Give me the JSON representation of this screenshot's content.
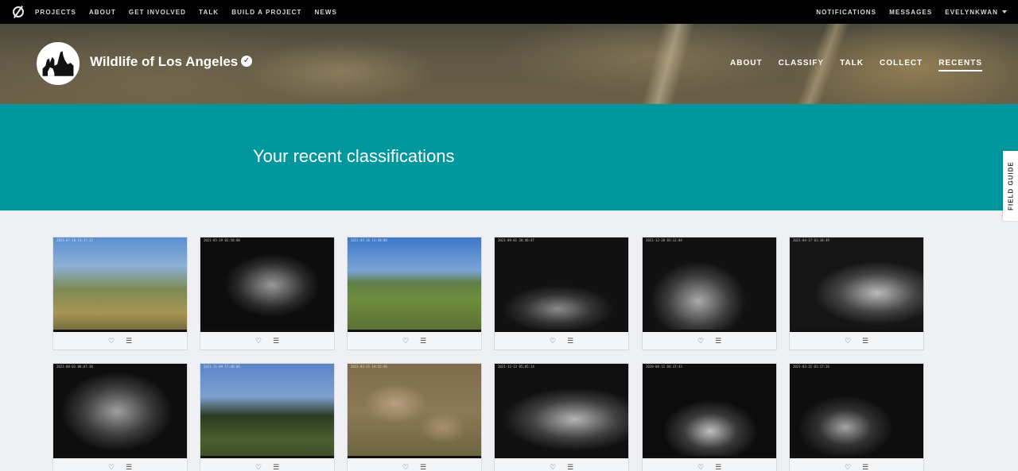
{
  "topnav": {
    "links": [
      "PROJECTS",
      "ABOUT",
      "GET INVOLVED",
      "TALK",
      "BUILD A PROJECT",
      "NEWS"
    ],
    "right": [
      "NOTIFICATIONS",
      "MESSAGES",
      "EVELYNKWAN"
    ]
  },
  "project": {
    "title": "Wildlife of Los Angeles",
    "nav": [
      "ABOUT",
      "CLASSIFY",
      "TALK",
      "COLLECT",
      "RECENTS"
    ],
    "active": "RECENTS"
  },
  "banner": {
    "heading": "Your recent classifications"
  },
  "fieldguide": {
    "label": "FIELD GUIDE"
  },
  "actions": {
    "favorite_icon": "♡",
    "collect_icon": "☰"
  },
  "cards": [
    {
      "scene": "day1",
      "stamp": "2021-07-10 13:17:33"
    },
    {
      "scene": "night1",
      "stamp": "2021-05-19 02:58:00"
    },
    {
      "scene": "day2",
      "stamp": "2021-05-26 13:38:00"
    },
    {
      "scene": "night2",
      "stamp": "2021-09-01 20:46:47"
    },
    {
      "scene": "night3",
      "stamp": "2021-12-20 03:12:04"
    },
    {
      "scene": "night4",
      "stamp": "2021-04-17 01:18:49"
    },
    {
      "scene": "night5",
      "stamp": "2021-08-03 00:07:30"
    },
    {
      "scene": "day4",
      "stamp": "2021-11-09 17:48:06"
    },
    {
      "scene": "day5",
      "stamp": "2021-03-21 14:52:46"
    },
    {
      "scene": "night6",
      "stamp": "2021-12-13 05:05:14"
    },
    {
      "scene": "night7",
      "stamp": "2020-08-11 04:37:43"
    },
    {
      "scene": "night8",
      "stamp": "2021-03-21 01:17:26"
    }
  ],
  "colors": {
    "banner": "#00979d",
    "topnav": "#000000",
    "page_bg": "#eef0f3"
  }
}
